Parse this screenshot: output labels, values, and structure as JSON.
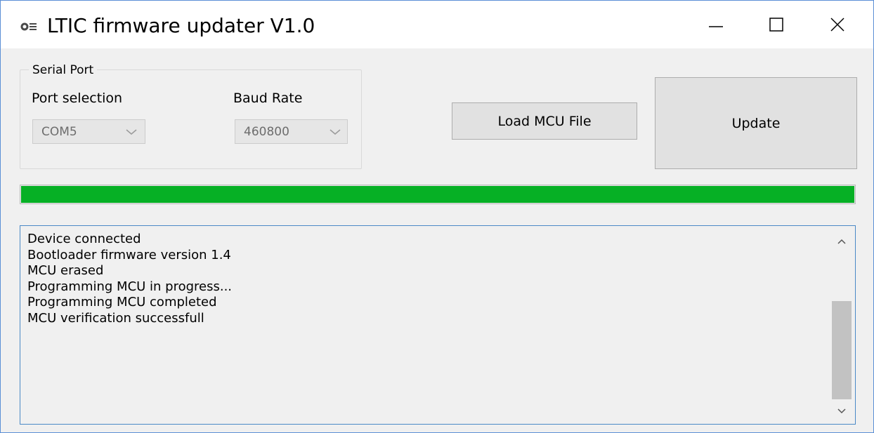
{
  "window": {
    "title": "LTIC firmware updater V1.0",
    "icon": "app-logo-icon",
    "controls": [
      "minimize-icon",
      "maximize-icon",
      "close-icon"
    ]
  },
  "serial_port": {
    "group_label": "Serial Port",
    "port_label": "Port selection",
    "port_value": "COM5",
    "baud_label": "Baud Rate",
    "baud_value": "460800"
  },
  "actions": {
    "load_label": "Load MCU File",
    "update_label": "Update"
  },
  "progress": {
    "value_percent": 100,
    "color": "#06b025"
  },
  "log": {
    "lines": [
      "Device connected",
      "Bootloader firmware version 1.4",
      "MCU erased",
      "Programming MCU in progress...",
      "Programming MCU completed",
      "MCU verification successfull"
    ]
  }
}
